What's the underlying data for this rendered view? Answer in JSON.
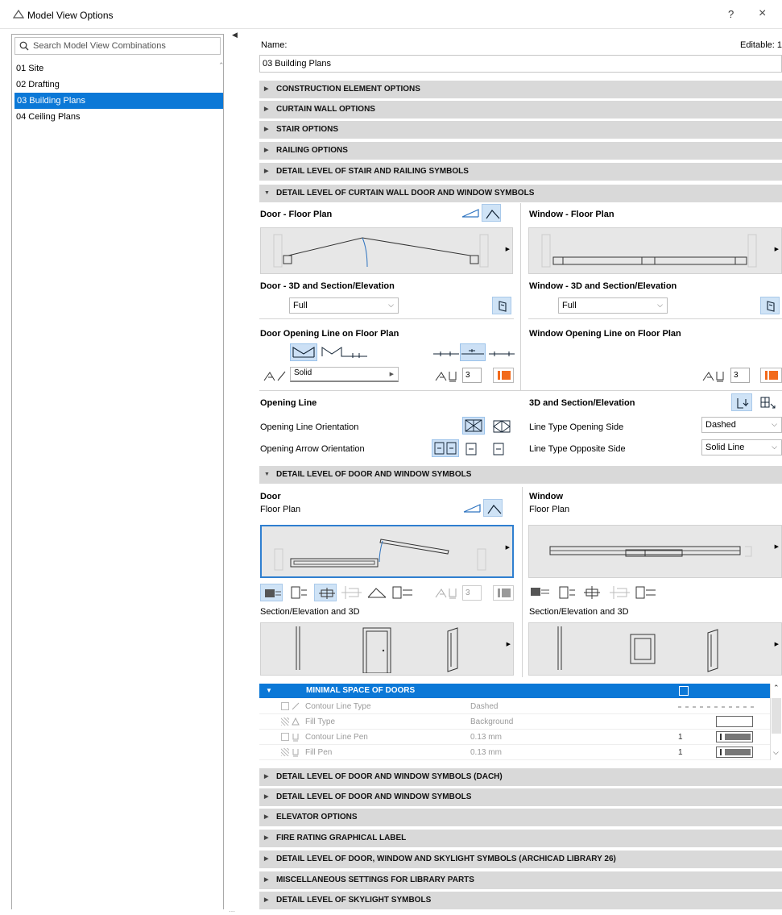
{
  "window": {
    "title": "Model View Options",
    "help": "?",
    "close": "×"
  },
  "left": {
    "search_placeholder": "Search Model View Combinations",
    "items": [
      "01 Site",
      "02 Drafting",
      "03 Building Plans",
      "04 Ceiling Plans"
    ],
    "selected_index": 2
  },
  "name": {
    "label": "Name:",
    "value": "03 Building Plans",
    "editable": "Editable: 1"
  },
  "collapsed_top": [
    "CONSTRUCTION ELEMENT OPTIONS",
    "CURTAIN WALL OPTIONS",
    "STAIR OPTIONS",
    "RAILING OPTIONS",
    "DETAIL LEVEL OF STAIR AND RAILING SYMBOLS"
  ],
  "cw": {
    "header": "DETAIL LEVEL OF CURTAIN WALL DOOR AND WINDOW SYMBOLS",
    "door_floor": "Door - Floor Plan",
    "window_floor": "Window - Floor Plan",
    "door_3d": "Door - 3D and Section/Elevation",
    "window_3d": "Window - 3D and Section/Elevation",
    "door_3d_value": "Full",
    "window_3d_value": "Full",
    "door_opening_line": "Door Opening Line on Floor Plan",
    "window_opening_line": "Window Opening Line on Floor Plan",
    "line_type": "Solid",
    "pen_door": "3",
    "pen_window": "3",
    "opening_line": "Opening Line",
    "opening_line_orientation": "Opening Line Orientation",
    "opening_arrow_orientation": "Opening Arrow Orientation",
    "section_3d": "3D and Section/Elevation",
    "line_type_opening_side": "Line Type Opening Side",
    "line_type_opening_side_value": "Dashed",
    "line_type_opposite_side": "Line Type Opposite Side",
    "line_type_opposite_side_value": "Solid Line"
  },
  "dw": {
    "header": "DETAIL LEVEL OF DOOR AND WINDOW SYMBOLS",
    "door": "Door",
    "window": "Window",
    "floor_plan": "Floor Plan",
    "section_3d": "Section/Elevation and 3D",
    "pen": "3"
  },
  "table": {
    "header": "MINIMAL SPACE OF DOORS",
    "rows": [
      {
        "label": "Contour Line Type",
        "value": "Dashed",
        "num": ""
      },
      {
        "label": "Fill Type",
        "value": "Background",
        "num": ""
      },
      {
        "label": "Contour Line Pen",
        "value": "0.13 mm",
        "num": "1"
      },
      {
        "label": "Fill Pen",
        "value": "0.13 mm",
        "num": "1"
      }
    ]
  },
  "collapsed_bottom": [
    "DETAIL LEVEL OF DOOR AND WINDOW SYMBOLS (DACH)",
    "DETAIL LEVEL OF DOOR AND WINDOW SYMBOLS",
    "ELEVATOR OPTIONS",
    "FIRE RATING GRAPHICAL LABEL",
    "DETAIL LEVEL OF DOOR, WINDOW AND SKYLIGHT SYMBOLS (ARCHICAD LIBRARY 26)",
    "MISCELLANEOUS SETTINGS FOR LIBRARY PARTS",
    "DETAIL LEVEL OF SKYLIGHT SYMBOLS"
  ],
  "colors": {
    "accent": "#0b78d7",
    "pen": "#f26a1b",
    "section_bg": "#d9d9d9"
  }
}
